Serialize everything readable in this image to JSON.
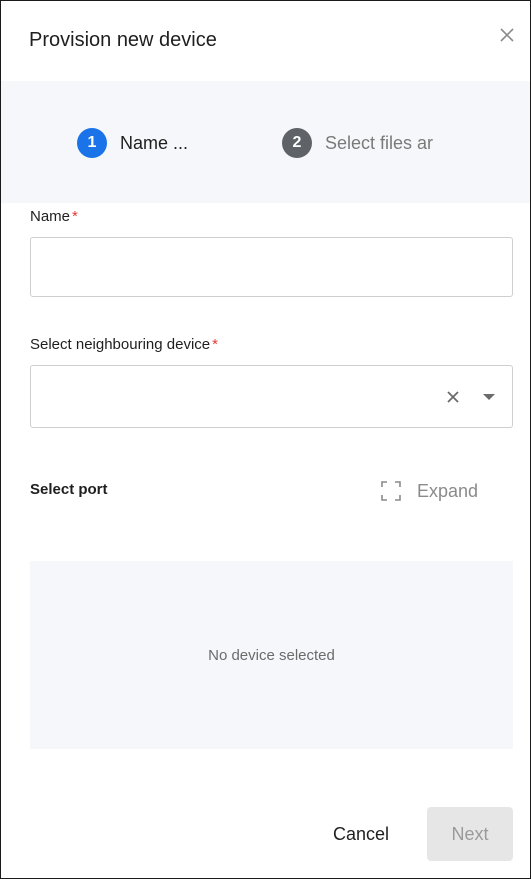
{
  "dialog": {
    "title": "Provision new device",
    "close_icon": "close-icon"
  },
  "stepper": {
    "steps": [
      {
        "number": "1",
        "label": "Name ...",
        "state": "active",
        "color": "#1a73e8"
      },
      {
        "number": "2",
        "label": "Select files ar",
        "state": "inactive",
        "color": "#5f6368"
      }
    ]
  },
  "form": {
    "name": {
      "label": "Name",
      "required_marker": "*",
      "value": "",
      "placeholder": ""
    },
    "neighbour": {
      "label": "Select neighbouring device",
      "required_marker": "*",
      "value": "",
      "clear_icon": "clear-icon",
      "dropdown_icon": "caret-down-icon"
    },
    "port": {
      "label": "Select port",
      "expand_label": "Expand",
      "expand_icon": "expand-icon",
      "empty_text": "No device selected"
    }
  },
  "footer": {
    "cancel_label": "Cancel",
    "next_label": "Next",
    "next_disabled": true
  },
  "colors": {
    "accent": "#1a73e8",
    "required": "#e53935",
    "panel_background": "#f5f7fa"
  }
}
